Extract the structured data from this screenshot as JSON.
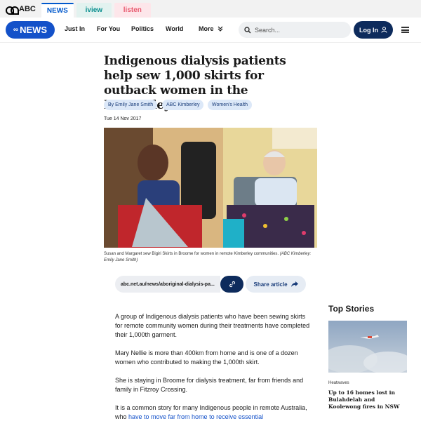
{
  "network": {
    "logo": "ABC",
    "tabs": [
      {
        "label": "NEWS"
      },
      {
        "label": "iview"
      },
      {
        "label": "listen"
      }
    ]
  },
  "nav": {
    "logo": "NEWS",
    "links": [
      "Just In",
      "For You",
      "Politics",
      "World",
      "More"
    ],
    "search_placeholder": "Search...",
    "login": "Log In"
  },
  "article": {
    "headline": "Indigenous dialysis patients help sew 1,000 skirts for outback women in the Kimberley",
    "tags": [
      "By Emily Jane Smith",
      "ABC Kimberley",
      "Women's Health"
    ],
    "date": "Tue 14 Nov 2017",
    "caption": "Susan and Margaret sew Bigiri Skirts in Broome for women in remote Kimberley communities.",
    "caption_credit": "(ABC Kimberley: Emily Jane Smith)",
    "share_url": "abc.net.au/news/aboriginal-dialysis-pa...",
    "share_label": "Share article",
    "paragraphs": [
      "A group of Indigenous dialysis patients who have been sewing skirts for remote community women during their treatments have completed their 1,000th garment.",
      "Mary Nellie is more than 400km from home and is one of a dozen women who contributed to making the 1,000th skirt.",
      "She is staying in Broome for dialysis treatment, far from friends and family in Fitzroy Crossing."
    ],
    "last_para_start": "It is a common story for many Indigenous people in remote Australia, who ",
    "last_para_link": "have to move far from home to receive essential"
  },
  "sidebar": {
    "heading": "Top Stories",
    "story_tag": "Heatwaves",
    "story_title": "Up to 16 homes lost in Bulahdelah and Koolewong fires in NSW"
  }
}
